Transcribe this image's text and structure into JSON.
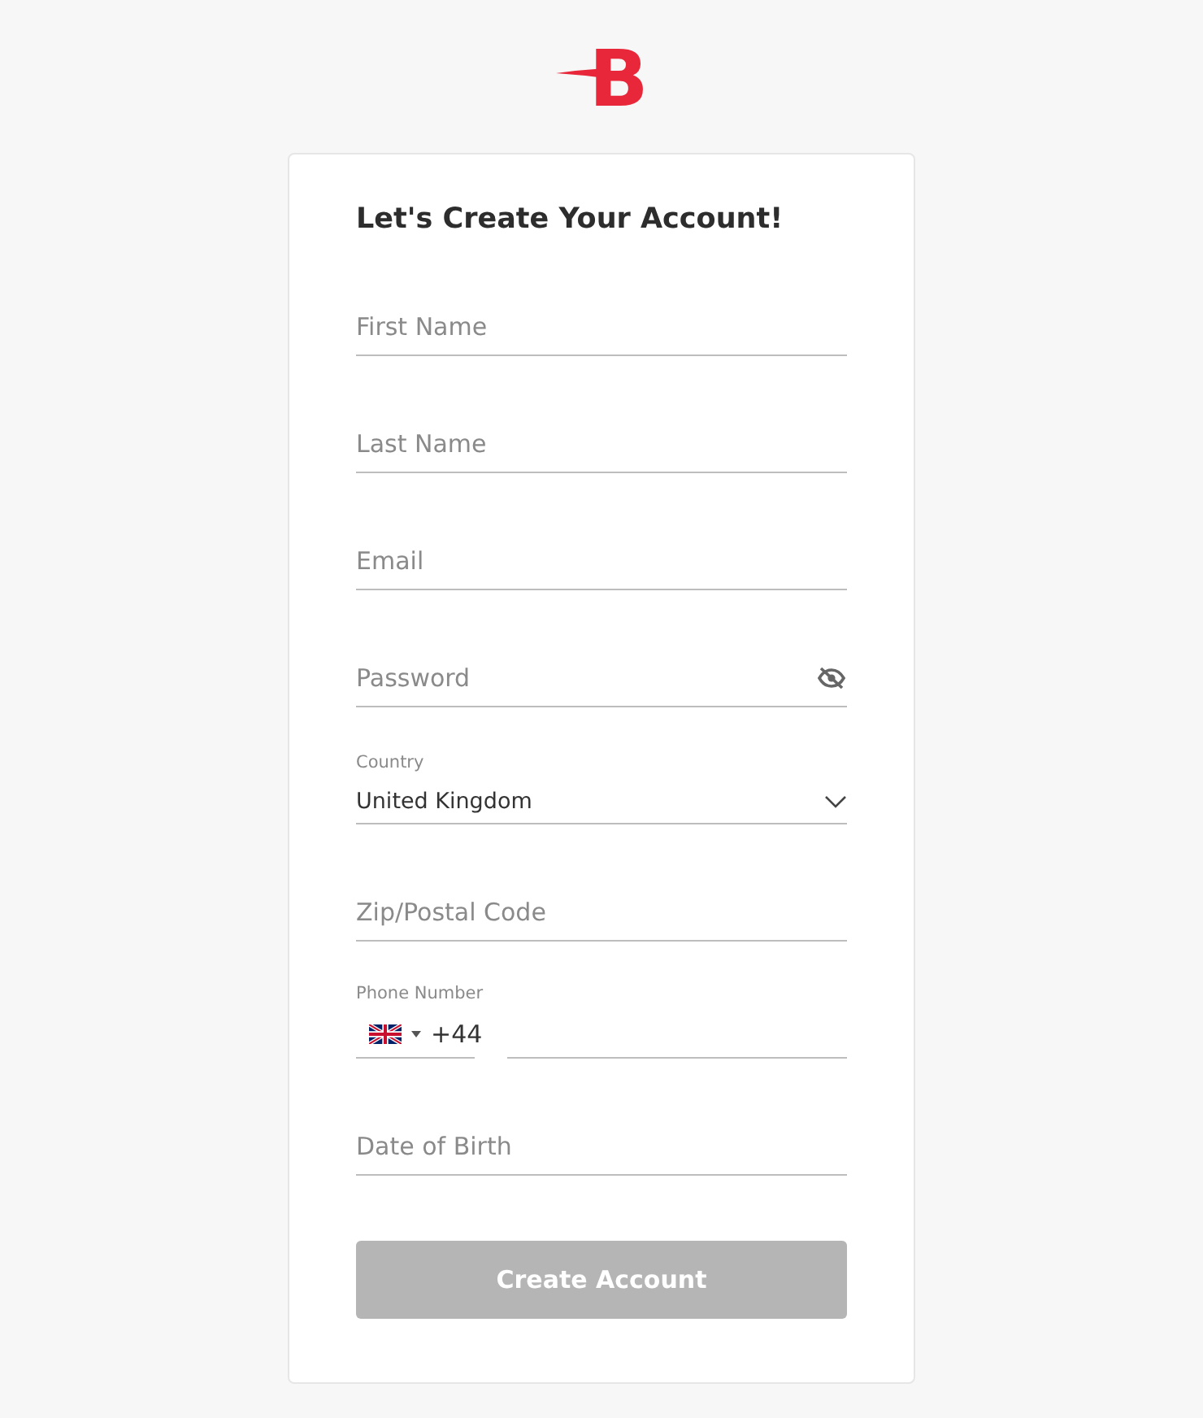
{
  "logo": {
    "text": "B"
  },
  "title": "Let's Create Your Account!",
  "fields": [
    {
      "kind": "text",
      "placeholder": "First Name"
    },
    {
      "kind": "text",
      "placeholder": "Last Name"
    },
    {
      "kind": "text",
      "placeholder": "Email"
    },
    {
      "kind": "password",
      "placeholder": "Password"
    },
    {
      "kind": "select",
      "label": "Country",
      "value": "United Kingdom"
    },
    {
      "kind": "text",
      "placeholder": "Zip/Postal Code"
    },
    {
      "kind": "phone",
      "label": "Phone Number",
      "code": "+44"
    },
    {
      "kind": "text",
      "placeholder": "Date of Birth"
    }
  ],
  "button": {
    "label": "Create Account",
    "disabled": true
  }
}
